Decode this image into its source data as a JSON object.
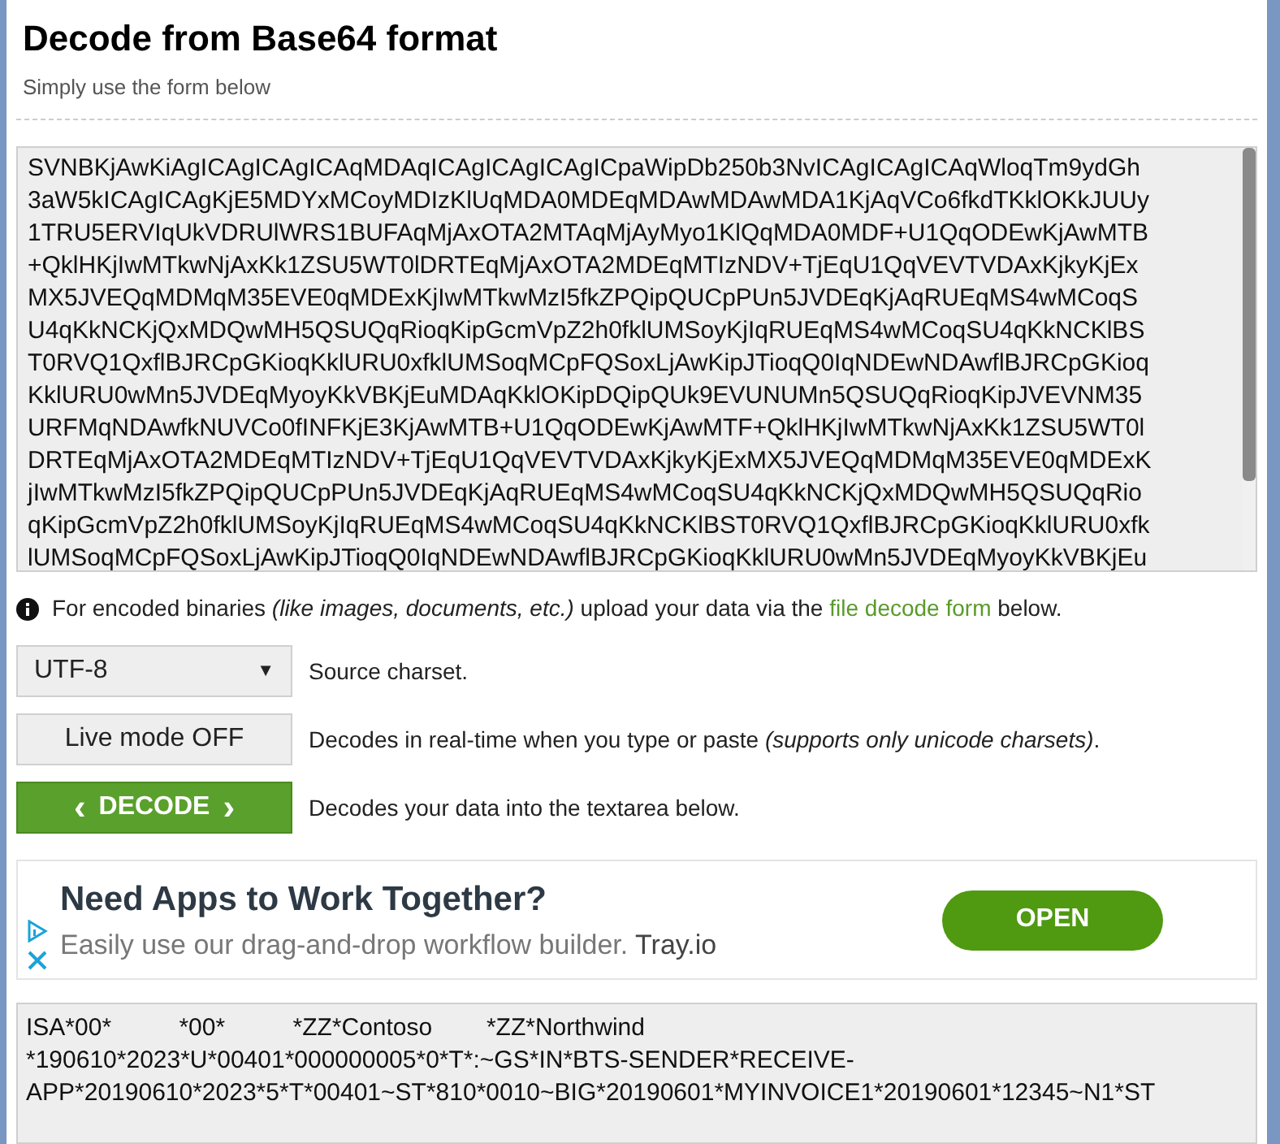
{
  "header": {
    "title": "Decode from Base64 format",
    "subtitle": "Simply use the form below"
  },
  "input": {
    "lines": [
      "SVNBKjAwKiAgICAgICAgICAqMDAqICAgICAgICAgICpaWipDb250b3NvICAgICAgICAqWloqTm9ydGh",
      "3aW5kICAgICAgKjE5MDYxMCoyMDIzKlUqMDA0MDEqMDAwMDAwMDA1KjAqVCo6fkdTKklOKkJUUy",
      "1TRU5ERVIqUkVDRUlWRS1BUFAqMjAxOTA2MTAqMjAyMyo1KlQqMDA0MDF+U1QqODEwKjAwMTB",
      "+QklHKjIwMTkwNjAxKk1ZSU5WT0lDRTEqMjAxOTA2MDEqMTIzNDV+TjEqU1QqVEVTVDAxKjkyKjEx",
      "MX5JVEQqMDMqM35EVE0qMDExKjIwMTkwMzI5fkZPQipQUCpPUn5JVDEqKjAqRUEqMS4wMCoqS",
      "U4qKkNCKjQxMDQwMH5QSUQqRioqKipGcmVpZ2h0fklUMSoyKjIqRUEqMS4wMCoqSU4qKkNCKlBS",
      "T0RVQ1QxflBJRCpGKioqKklURU0xfklUMSoqMCpFQSoxLjAwKipJTioqQ0IqNDEwNDAwflBJRCpGKioq",
      "KklURU0wMn5JVDEqMyoyKkVBKjEuMDAqKklOKipDQipQUk9EVUNUMn5QSUQqRioqKipJVEVNM35",
      "URFMqNDAwfkNUVCo0fINFKjE3KjAwMTB+U1QqODEwKjAwMTF+QklHKjIwMTkwNjAxKk1ZSU5WT0l",
      "DRTEqMjAxOTA2MDEqMTIzNDV+TjEqU1QqVEVTVDAxKjkyKjExMX5JVEQqMDMqM35EVE0qMDExK",
      "jIwMTkwMzI5fkZPQipQUCpPUn5JVDEqKjAqRUEqMS4wMCoqSU4qKkNCKjQxMDQwMH5QSUQqRio",
      "qKipGcmVpZ2h0fklUMSoyKjIqRUEqMS4wMCoqSU4qKkNCKlBST0RVQ1QxflBJRCpGKioqKklURU0xfk",
      "lUMSoqMCpFQSoxLjAwKipJTioqQ0IqNDEwNDAwflBJRCpGKioqKklURU0wMn5JVDEqMyoyKkVBKjEu"
    ]
  },
  "notice": {
    "before": "For encoded binaries",
    "italic": "(like images, documents, etc.)",
    "middle": "upload your data via the",
    "link": "file decode form",
    "after": "below."
  },
  "options": [
    {
      "kind": "select",
      "value": "UTF-8",
      "caret": "▼",
      "description": "Source charset."
    },
    {
      "kind": "toggle",
      "label": "Live mode OFF",
      "on": false,
      "description": "Decodes in real-time when you type or paste",
      "note": "(supports only unicode charsets)",
      "end": "."
    },
    {
      "kind": "action",
      "left": "‹",
      "label": "DECODE",
      "right": "›",
      "description": "Decodes your data into the textarea below."
    }
  ],
  "ad": {
    "headline": "Need Apps to Work Together?",
    "text": "Easily use our drag-and-drop workflow builder.",
    "brand": "Tray.io",
    "button": "OPEN"
  },
  "output": {
    "lines": [
      "ISA*00*          *00*          *ZZ*Contoso        *ZZ*Northwind",
      "*190610*2023*U*00401*000000005*0*T*:~GS*IN*BTS-SENDER*RECEIVE-",
      "APP*20190610*2023*5*T*00401~ST*810*0010~BIG*20190601*MYINVOICE1*20190601*12345~N1*ST"
    ]
  }
}
